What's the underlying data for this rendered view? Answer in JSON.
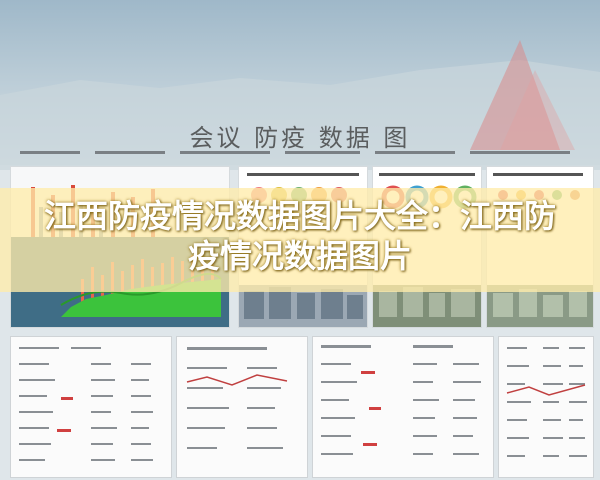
{
  "banner": {
    "title": "江西防疫情况数据图片大全：江西防疫情况数据图片"
  }
}
